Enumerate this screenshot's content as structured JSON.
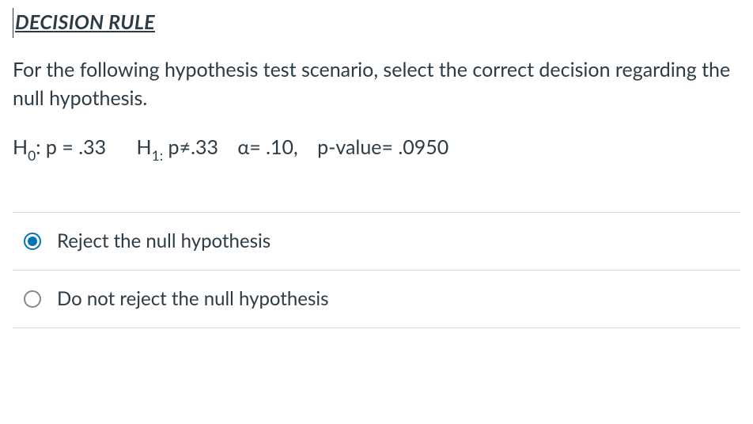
{
  "title": "DECISION RULE",
  "prompt": "For the following hypothesis test scenario, select the correct decision regarding the null hypothesis.",
  "hypotheses": {
    "h0_prefix": "H",
    "h0_sub": "0",
    "h0_text": ": p = .33",
    "h1_prefix": "H",
    "h1_sub": "1:",
    "h1_text": " p≠.33",
    "alpha_text": "α= .10,",
    "pvalue_text": "p-value= .0950"
  },
  "options": [
    {
      "label": "Reject the null hypothesis",
      "selected": true
    },
    {
      "label": "Do not reject the null hypothesis",
      "selected": false
    }
  ]
}
